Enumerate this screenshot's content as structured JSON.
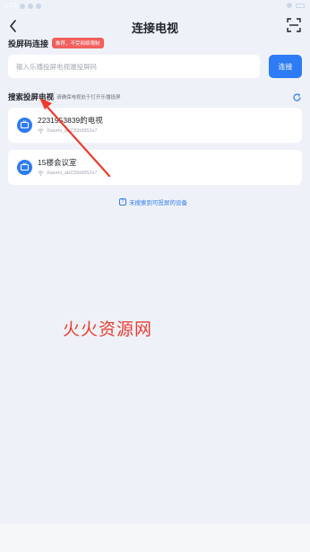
{
  "status_bar": {
    "time": "1:13"
  },
  "nav": {
    "title": "连接电视"
  },
  "code_section": {
    "title": "投屏码连接",
    "tip": "推荐，不受网络限制",
    "input_placeholder": "输入乐播投屏电视端投屏码",
    "connect_label": "连接"
  },
  "search_section": {
    "title": "搜索投屏电视",
    "hint": "请确保电视处于打开乐播投屏"
  },
  "devices": [
    {
      "name": "2231953839的电视",
      "sub": "Xiaomi_ab235b6852e7"
    },
    {
      "name": "15楼会议室",
      "sub": "Xiaomi_ab235b6852e7"
    }
  ],
  "help": {
    "icon": "?",
    "text": "未搜索到可投屏的设备"
  },
  "watermark": "火火资源网",
  "colors": {
    "accent": "#2e7bf6",
    "badge": "#f25f5c",
    "annotation": "#ee3b2e"
  }
}
